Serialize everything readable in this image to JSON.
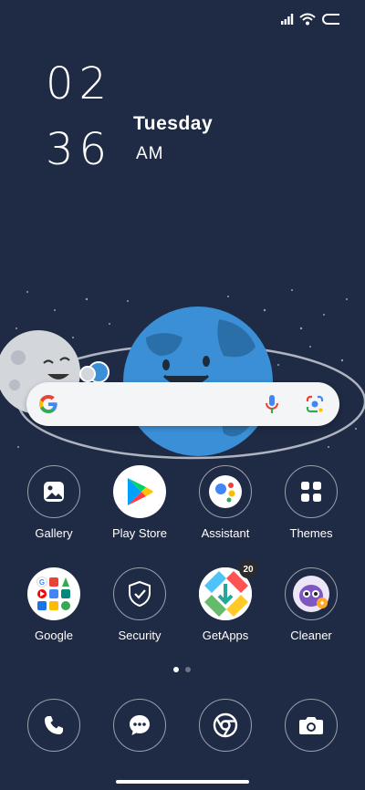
{
  "status_bar": {
    "icons": [
      "signal-icon",
      "wifi-icon",
      "battery-icon"
    ]
  },
  "clock": {
    "hours": "02",
    "minutes": "36",
    "day": "Tuesday",
    "meridiem": "AM"
  },
  "search_bar": {
    "icons": [
      "google-g-icon",
      "microphone-icon",
      "google-lens-icon"
    ]
  },
  "apps_row1": [
    {
      "label": "Gallery",
      "icon": "gallery-icon"
    },
    {
      "label": "Play Store",
      "icon": "play-store-icon"
    },
    {
      "label": "Assistant",
      "icon": "assistant-icon"
    },
    {
      "label": "Themes",
      "icon": "themes-icon"
    }
  ],
  "apps_row2": [
    {
      "label": "Google",
      "icon": "google-folder-icon"
    },
    {
      "label": "Security",
      "icon": "shield-icon"
    },
    {
      "label": "GetApps",
      "icon": "getapps-icon",
      "badge": "20"
    },
    {
      "label": "Cleaner",
      "icon": "cleaner-icon"
    }
  ],
  "page_indicator": {
    "pages": 2,
    "active": 1
  },
  "dock": [
    {
      "icon": "phone-icon"
    },
    {
      "icon": "messages-icon"
    },
    {
      "icon": "chrome-icon"
    },
    {
      "icon": "camera-icon"
    }
  ],
  "colors": {
    "background": "#1f2a44",
    "earth": "#3a8fd6",
    "moon": "#d9d9d9"
  }
}
